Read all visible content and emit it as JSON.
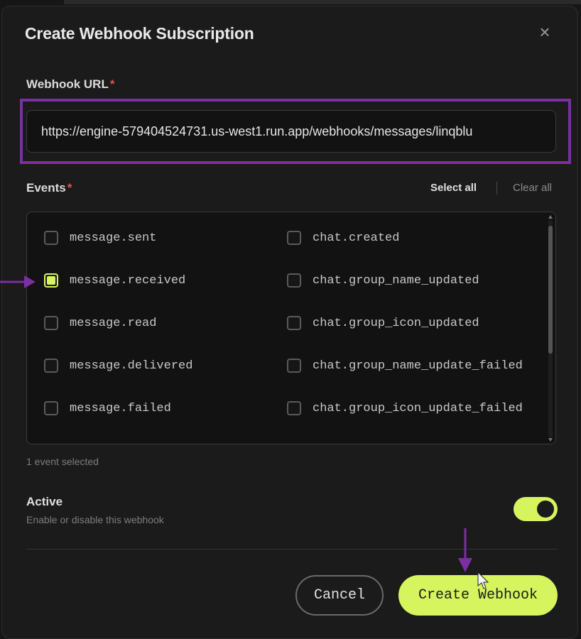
{
  "dialog": {
    "title": "Create Webhook Subscription",
    "close_symbol": "×"
  },
  "url_field": {
    "label": "Webhook URL",
    "required_mark": "*",
    "value": "https://engine-579404524731.us-west1.run.app/webhooks/messages/linqblu"
  },
  "events": {
    "label": "Events",
    "required_mark": "*",
    "select_all": "Select all",
    "clear_all": "Clear all",
    "items": [
      {
        "label": "message.sent",
        "checked": false
      },
      {
        "label": "chat.created",
        "checked": false
      },
      {
        "label": "message.received",
        "checked": true
      },
      {
        "label": "chat.group_name_updated",
        "checked": false
      },
      {
        "label": "message.read",
        "checked": false
      },
      {
        "label": "chat.group_icon_updated",
        "checked": false
      },
      {
        "label": "message.delivered",
        "checked": false
      },
      {
        "label": "chat.group_name_update_failed",
        "checked": false
      },
      {
        "label": "message.failed",
        "checked": false
      },
      {
        "label": "chat.group_icon_update_failed",
        "checked": false
      }
    ],
    "selected_count_text": "1 event selected"
  },
  "active": {
    "label": "Active",
    "description": "Enable or disable this webhook",
    "enabled": true
  },
  "footer": {
    "cancel_label": "Cancel",
    "create_label": "Create Webhook"
  },
  "colors": {
    "accent": "#d6f45e",
    "annotation": "#7a2fa3",
    "required": "#e05252"
  }
}
